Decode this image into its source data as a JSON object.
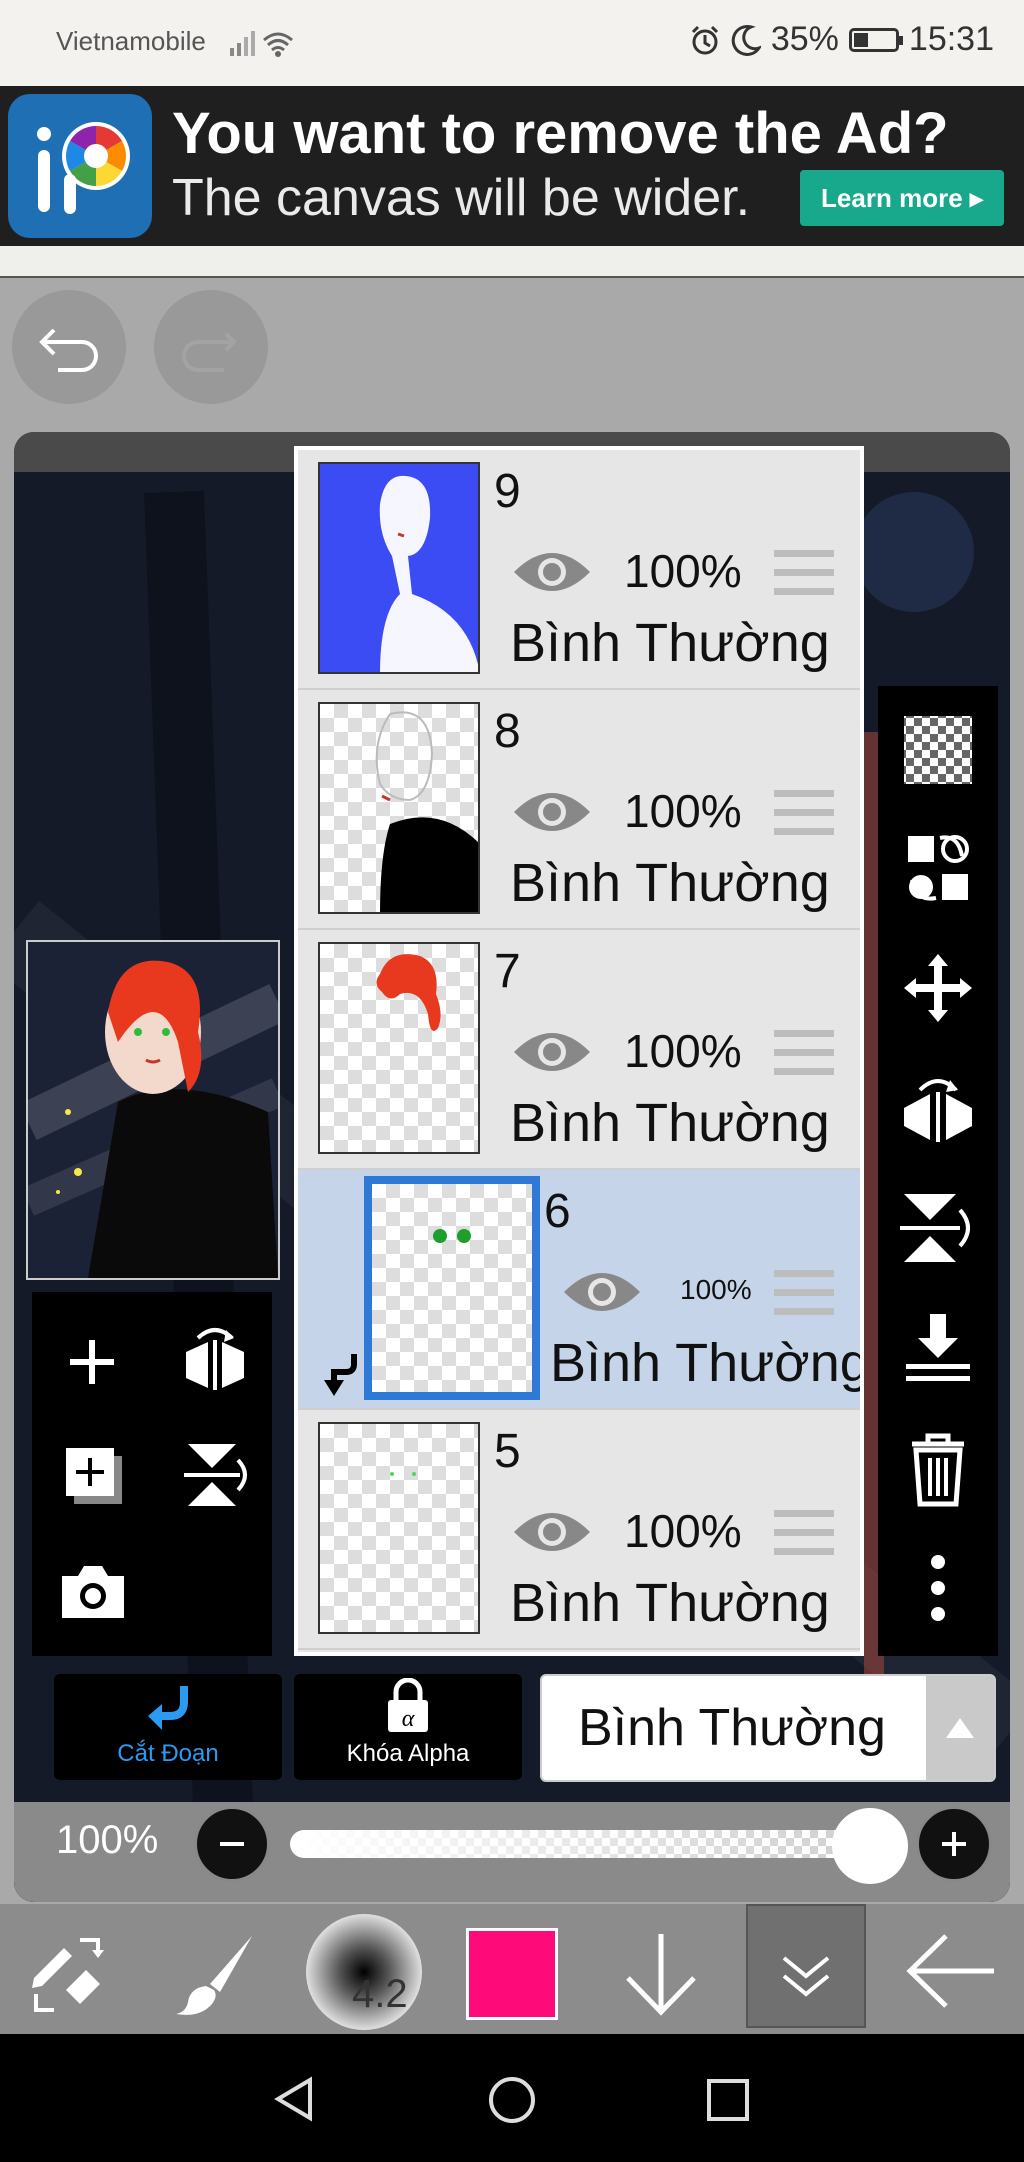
{
  "status_bar": {
    "carrier": "Vietnamobile",
    "battery": "35%",
    "time": "15:31"
  },
  "ad": {
    "title": "You want to remove the Ad?",
    "subtitle": "The canvas will be wider.",
    "button": "Learn more ▸"
  },
  "layers": [
    {
      "number": "9",
      "opacity": "100%",
      "blend": "Bình Thường",
      "selected": false
    },
    {
      "number": "8",
      "opacity": "100%",
      "blend": "Bình Thường",
      "selected": false
    },
    {
      "number": "7",
      "opacity": "100%",
      "blend": "Bình Thường",
      "selected": false
    },
    {
      "number": "6",
      "opacity": "100%",
      "blend": "Bình Thường",
      "selected": true
    },
    {
      "number": "5",
      "opacity": "100%",
      "blend": "Bình Thường",
      "selected": false
    }
  ],
  "bottom_controls": {
    "clipping_label": "Cắt Đoạn",
    "alpha_lock_label": "Khóa Alpha",
    "blend_mode": "Bình Thường"
  },
  "opacity": {
    "label": "100%",
    "value": 1.0
  },
  "brush": {
    "size": "4.2"
  },
  "colors": {
    "current": "#ff0a78",
    "selection": "#2e79d6",
    "accent": "#18a98c"
  }
}
